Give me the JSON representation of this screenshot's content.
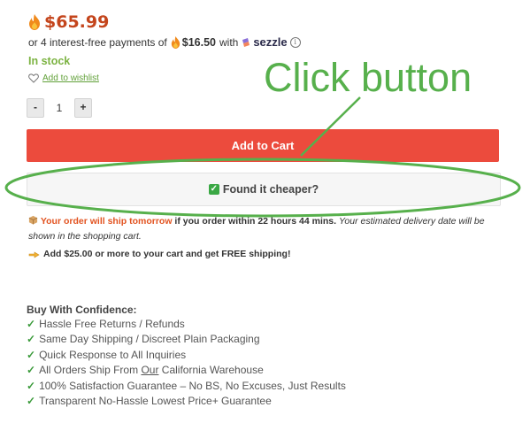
{
  "product": {
    "price": "$65.99",
    "installments_prefix": "or 4 interest-free payments of",
    "installment_amount": "$16.50",
    "installments_with": "with",
    "sezzle_label": "sezzle",
    "stock_status": "In stock",
    "wishlist_label": "Add to wishlist"
  },
  "quantity": {
    "minus_label": "-",
    "value": "1",
    "plus_label": "+"
  },
  "buttons": {
    "add_to_cart": "Add to Cart",
    "found_cheaper": "Found it cheaper?"
  },
  "shipping": {
    "ship_tomorrow": "Your order will ship tomorrow",
    "order_within": "if you order within 22 hours 44 mins.",
    "estimated": "Your estimated delivery date will be shown in the shopping cart.",
    "free_shipping": "Add $25.00 or more to your cart and get FREE shipping!"
  },
  "confidence": {
    "title": "Buy With Confidence:",
    "items": [
      "Hassle Free Returns / Refunds",
      "Same Day Shipping / Discreet Plain Packaging",
      "Quick Response to All Inquiries",
      "All Orders Ship From",
      "100% Satisfaction Guarantee – No BS, No Excuses, Just Results",
      "Transparent No-Hassle Lowest Price+ Guarantee"
    ],
    "item4_underlined": "Our",
    "item4_suffix": "California Warehouse"
  },
  "annotation": {
    "text": "Click button",
    "color": "#57b04c"
  },
  "icons": [
    "flame-icon",
    "sezzle-logo-icon",
    "info-icon",
    "heart-icon",
    "checkbox-icon",
    "box-icon",
    "pointing-hand-icon",
    "check-icon"
  ],
  "colors": {
    "price": "#c4451c",
    "add_to_cart_bg": "#ec4b3d",
    "in_stock": "#7cb342",
    "ship_tomorrow": "#e25320"
  }
}
